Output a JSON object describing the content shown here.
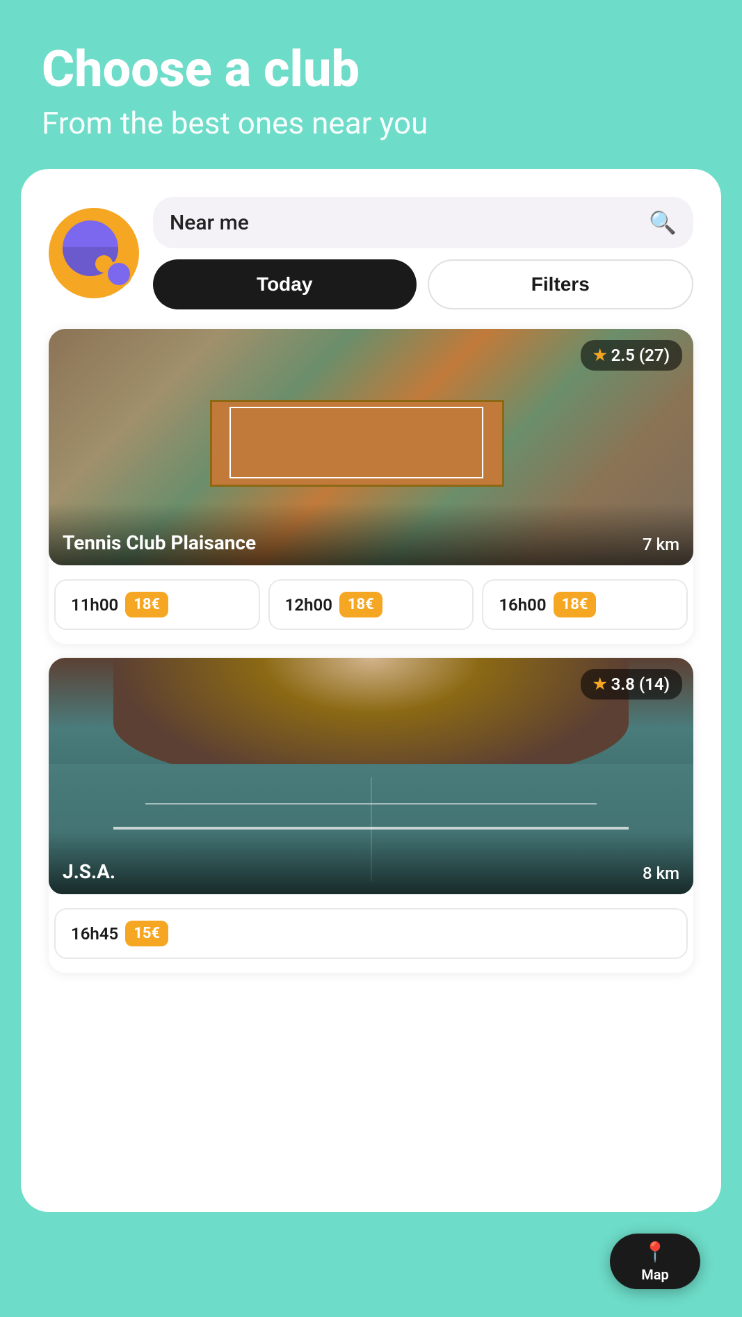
{
  "header": {
    "title": "Choose a club",
    "subtitle": "From the best ones near you"
  },
  "search": {
    "placeholder": "Near me",
    "value": "Near me"
  },
  "buttons": {
    "today": "Today",
    "filters": "Filters",
    "map": "Map"
  },
  "clubs": [
    {
      "id": "club-1",
      "name": "Tennis Club Plaisance",
      "distance": "7 km",
      "rating": "2.5",
      "review_count": "27",
      "type": "aerial",
      "slots": [
        {
          "time": "11h00",
          "price": "18€"
        },
        {
          "time": "12h00",
          "price": "18€"
        },
        {
          "time": "16h00",
          "price": "18€"
        }
      ]
    },
    {
      "id": "club-2",
      "name": "J.S.A.",
      "distance": "8 km",
      "rating": "3.8",
      "review_count": "14",
      "type": "indoor",
      "slots": [
        {
          "time": "16h45",
          "price": "15€"
        }
      ]
    }
  ],
  "icons": {
    "search": "🔍",
    "star": "★",
    "map_pin": "📍"
  }
}
